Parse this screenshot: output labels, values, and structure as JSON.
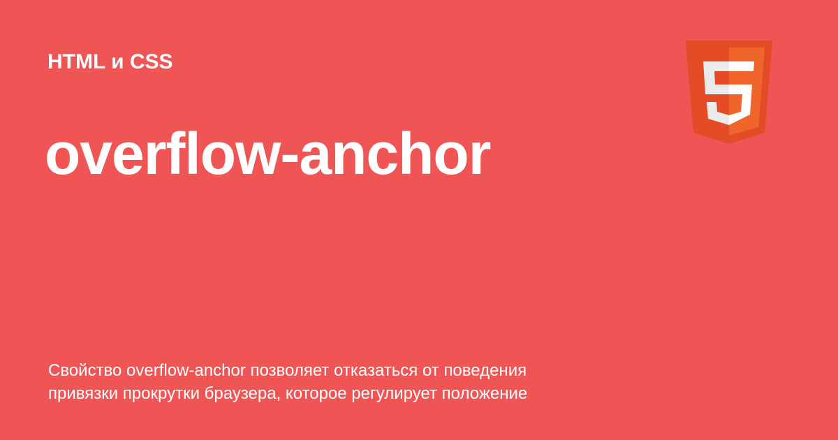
{
  "card": {
    "category": "HTML и CSS",
    "title": "overflow-anchor",
    "description_lines": [
      "Свойство overflow-anchor позволяет отказаться от поведения",
      "привязки прокрутки браузера, которое регулирует положение"
    ],
    "logo": {
      "icon": "html5-logo-icon",
      "glyph": "5",
      "colors": {
        "shield_dark": "#e34c26",
        "shield_light": "#f06529",
        "glyph_left": "#ebebeb",
        "glyph_right": "#ffffff"
      }
    },
    "colors": {
      "background": "#ef5555",
      "text": "#ffffff"
    }
  }
}
